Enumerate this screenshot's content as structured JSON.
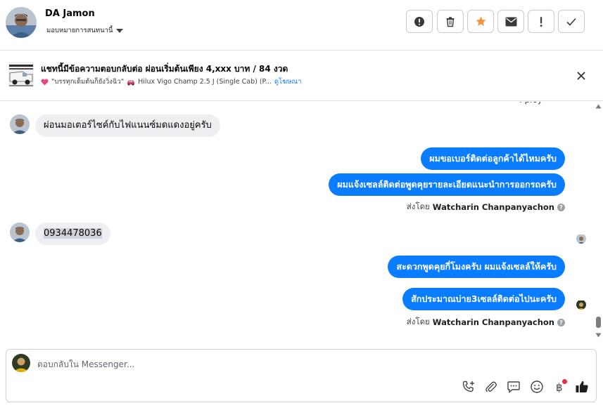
{
  "header": {
    "contact_name": "DA Jamon",
    "assign_label": "มอบหมายการสนทนานี้",
    "actions": [
      {
        "name": "report-icon"
      },
      {
        "name": "trash-icon"
      },
      {
        "name": "star-icon",
        "color": "#f7923b"
      },
      {
        "name": "mail-icon"
      },
      {
        "name": "exclamation-icon"
      },
      {
        "name": "check-icon"
      }
    ]
  },
  "ad": {
    "title": "แชทนี้มีข้อความตอบกลับต่อ ผ่อนเริ่มต้นเพียง 4,xxx บาท / 84 งวด",
    "subtitle": "\"บรรทุกเต็มต้นก็ยังวิ่งฉิว\"",
    "vehicle": "Hilux Vigo Champ 2.5 J (Single Cab) (P...",
    "link": "ดูโฆษณา"
  },
  "messages": {
    "in_1": "ผ่อนมอเตอร์ไซค์กับไฟแนนซ์มดแดงอยู่ครับ",
    "out_1": "ผมขอเบอร์ติดต่อลูกค้าได้ไหมครับ",
    "out_2": "ผมแจ้งเซลล์ติดต่อพูดคุยรายละเอียดแนะนำการออกรถครับ",
    "sent_by_label_1": "ส่งโดย",
    "sent_by_name_1": "Watcharin Chanpanyachon",
    "in_2": "0934478036",
    "out_3": "สะดวกพูดคุยกี่โมงครับ ผมแจ้งเซลล์ให้ครับ",
    "out_4": "สักประมาณบ่าย3เซลล์ติดต่อไปนะครับ",
    "sent_by_label_2": "ส่งโดย",
    "sent_by_name_2": "Watcharin Chanpanyachon"
  },
  "composer": {
    "placeholder": "ตอบกลับใน Messenger...",
    "tools": [
      "call-add-icon",
      "paperclip-icon",
      "chat-bubble-icon",
      "emoji-icon",
      "baht-icon",
      "thumbs-up-icon"
    ]
  },
  "colors": {
    "outgoing_bubble": "#0a7cff",
    "incoming_bubble": "#eeeff2",
    "like": "#1c1e21"
  }
}
